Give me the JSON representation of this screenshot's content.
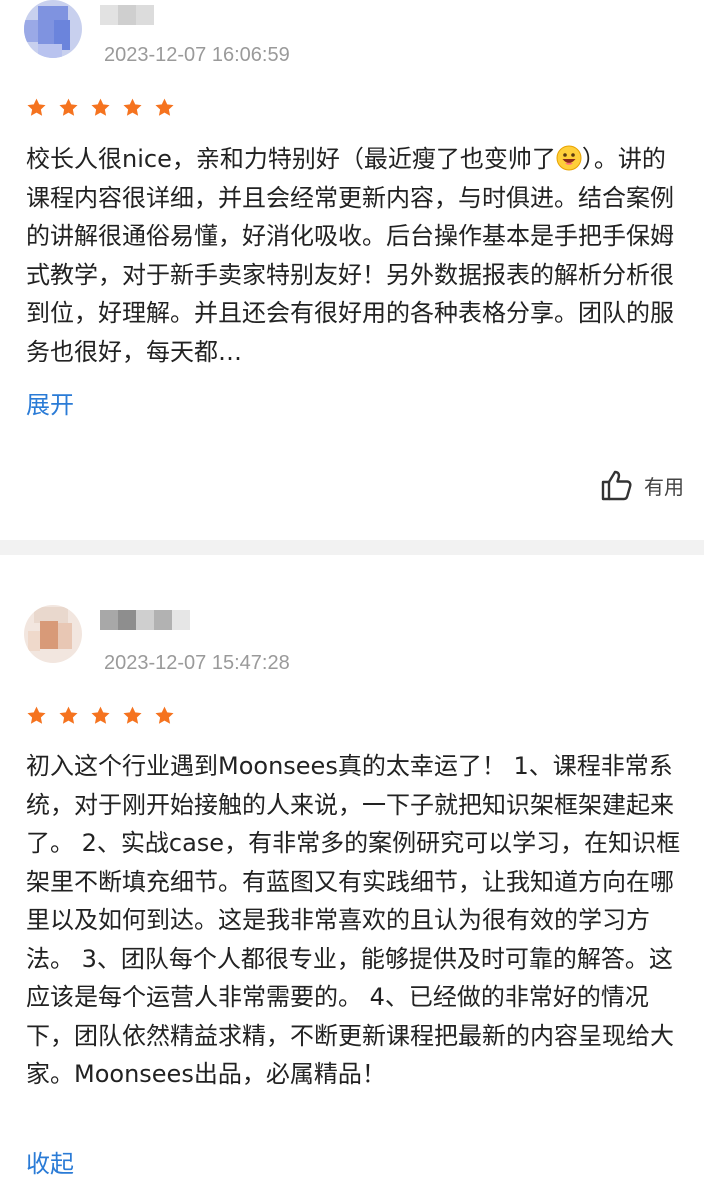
{
  "reviews": [
    {
      "date": "2023-12-07 16:06:59",
      "rating": 5,
      "text_before_emoji": "校长人很nice，亲和力特别好（最近瘦了也变帅了",
      "emoji": "grinning-face-emoji",
      "text_after_emoji": "）。讲的课程内容很详细，并且会经常更新内容，与时俱进。结合案例的讲解很通俗易懂，好消化吸收。后台操作基本是手把手保姆式教学，对于新手卖家特别友好！另外数据报表的解析分析很到位，好理解。并且还会有很好用的各种表格分享。团队的服务也很好，每天都…",
      "toggle_label": "展开",
      "useful_label": "有用"
    },
    {
      "date": "2023-12-07 15:47:28",
      "rating": 5,
      "text": "初入这个行业遇到Moonsees真的太幸运了！ 1、课程非常系统，对于刚开始接触的人来说，一下子就把知识架框架建起来了。 2、实战case，有非常多的案例研究可以学习，在知识框架里不断填充细节。有蓝图又有实践细节，让我知道方向在哪里以及如何到达。这是我非常喜欢的且认为很有效的学习方法。 3、团队每个人都很专业，能够提供及时可靠的解答。这应该是每个运营人非常需要的。 4、已经做的非常好的情况下，团队依然精益求精，不断更新课程把最新的内容呈现给大家。Moonsees出品，必属精品！",
      "toggle_label": "收起"
    }
  ],
  "colors": {
    "star": "#f5731f",
    "link": "#2a7bd6",
    "date": "#9a9a9a",
    "divider": "#f2f2f2"
  },
  "icons": {
    "star": "star-icon",
    "useful": "thumbs-up-icon"
  }
}
